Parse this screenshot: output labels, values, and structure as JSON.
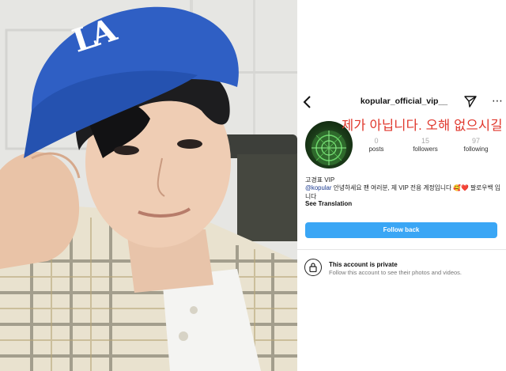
{
  "profile": {
    "username": "kopular_official_vip__",
    "overlay_caption": "제가 아닙니다. 오해 없으시길",
    "stats": [
      {
        "count": "0",
        "label": "posts"
      },
      {
        "count": "15",
        "label": "followers"
      },
      {
        "count": "97",
        "label": "following"
      }
    ],
    "bio_name": "고경표  VIP",
    "bio_mention": "@kopular",
    "bio_text": " 안녕하세요 팬 여러분, 제 VIP 전용 계정입니다 🥰❤️ 팔로우백 입니다",
    "see_translation": "See Translation",
    "follow_button": "Follow back",
    "private_title": "This account is private",
    "private_subtitle": "Follow this account to see their photos and videos."
  },
  "photo": {
    "cap_text": "LA"
  },
  "icons": {
    "back": "chevron-left-icon",
    "send": "paper-plane-icon",
    "more": "more-dots-icon",
    "lock": "lock-icon"
  },
  "colors": {
    "follow_button": "#3aa6f5",
    "caption": "#e0362b",
    "mention": "#1b3a8f",
    "cap": "#2f5fc4"
  }
}
